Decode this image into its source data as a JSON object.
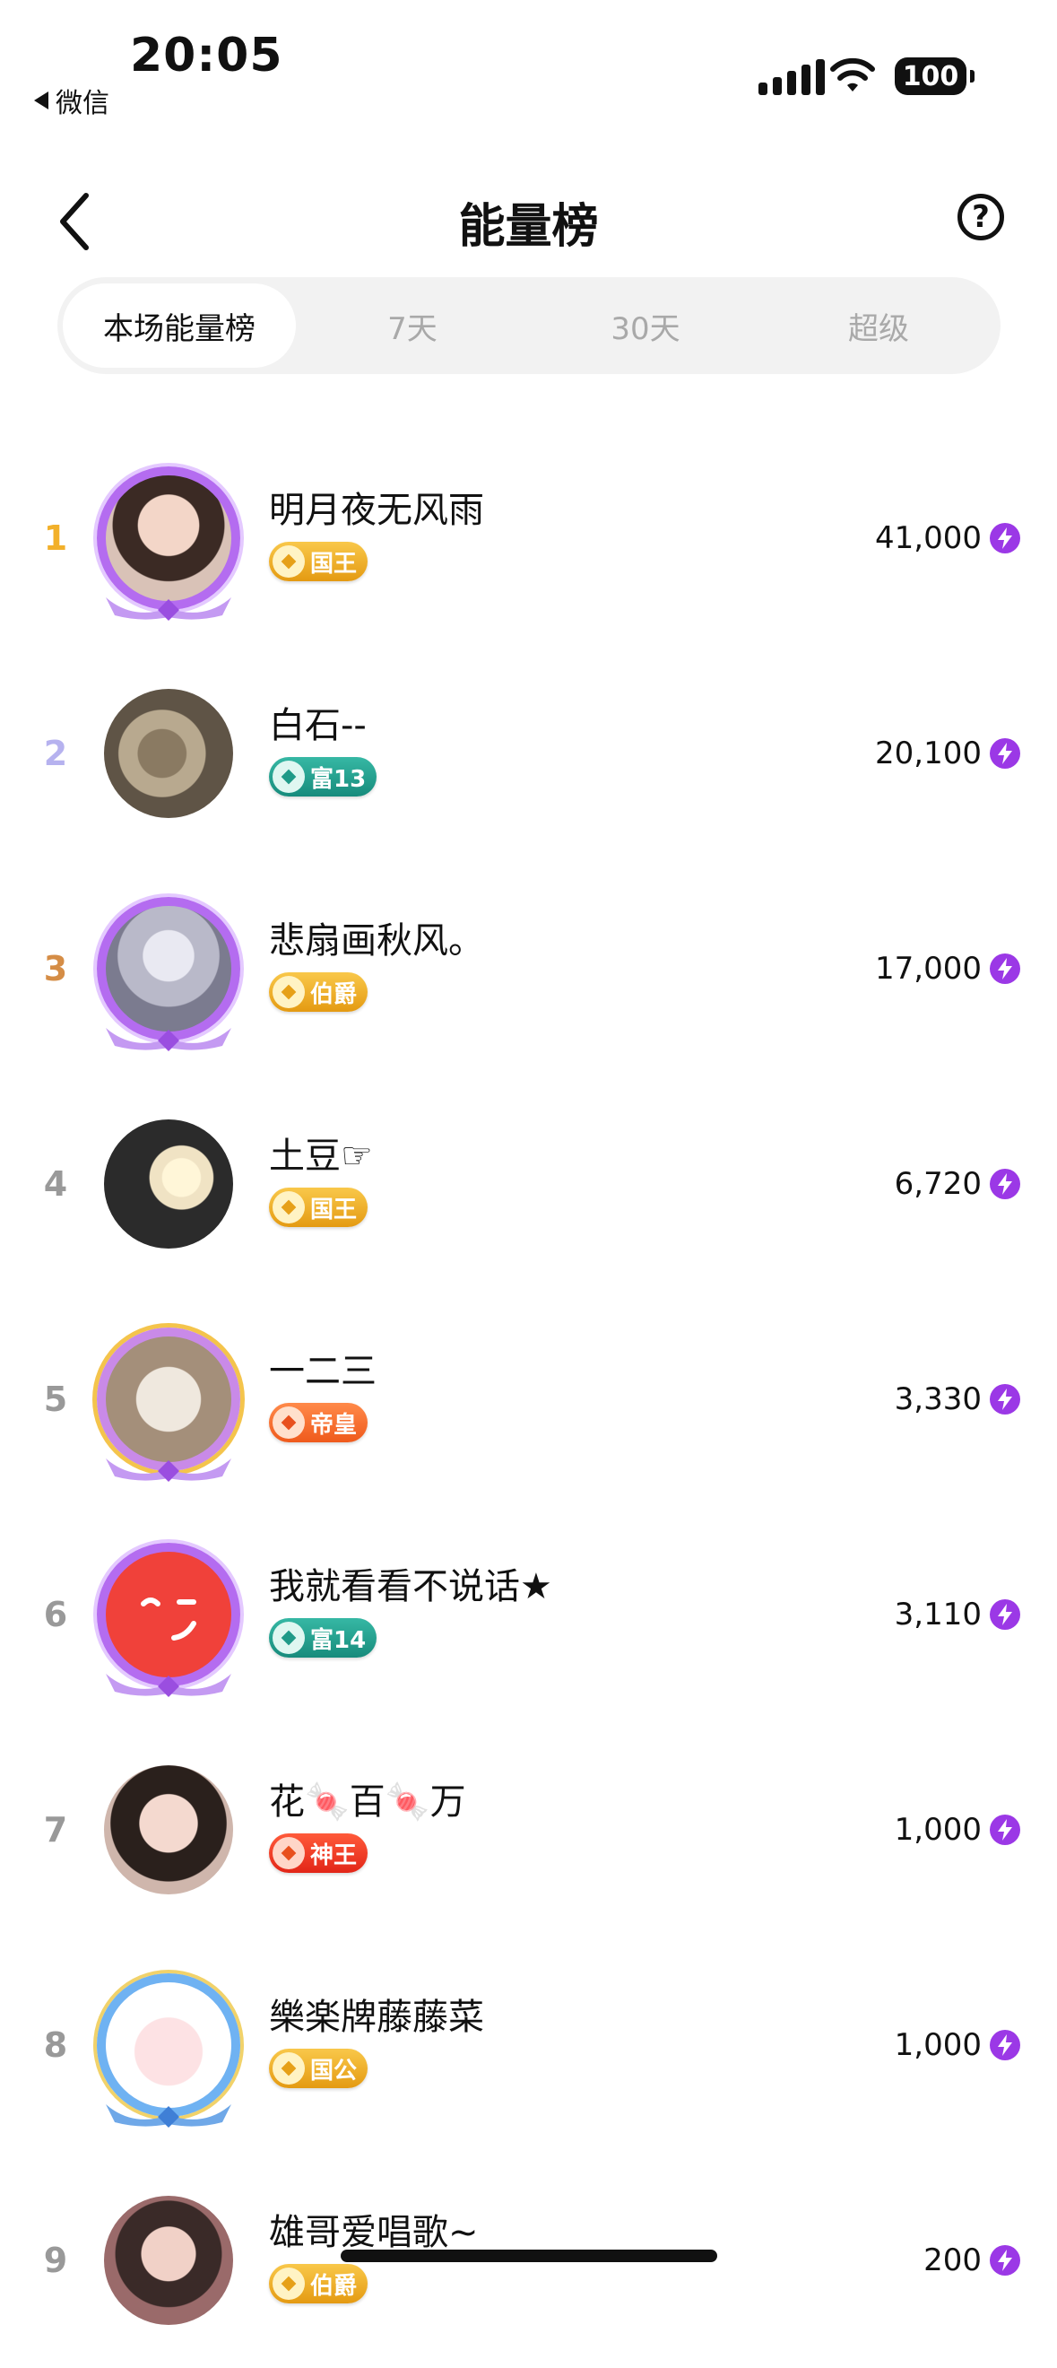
{
  "status_bar": {
    "time": "20:05",
    "back_app": "微信",
    "battery": "100"
  },
  "header": {
    "title": "能量榜",
    "help": "?"
  },
  "tabs": [
    {
      "label": "本场能量榜",
      "active": true
    },
    {
      "label": "7天",
      "active": false
    },
    {
      "label": "30天",
      "active": false
    },
    {
      "label": "超级",
      "active": false
    }
  ],
  "colors": {
    "rank1": "#f2b02a",
    "rank2": "#b6b2ef",
    "rank3": "#d58d46",
    "rank_default": "#999999",
    "bolt": "#9b38e6"
  },
  "entries": [
    {
      "rank": "1",
      "name": "明月夜无风雨",
      "badge": "国王",
      "badge_style": "gold",
      "score": "41,000",
      "frame": "purple",
      "avatar_icon": "girl-avatar"
    },
    {
      "rank": "2",
      "name": "白石--",
      "badge": "富13",
      "badge_style": "teal",
      "score": "20,100",
      "frame": "none",
      "avatar_icon": "animals-avatar"
    },
    {
      "rank": "3",
      "name": "悲扇画秋风。",
      "badge": "伯爵",
      "badge_style": "gold",
      "score": "17,000",
      "frame": "purple",
      "avatar_icon": "warrior-avatar"
    },
    {
      "rank": "4",
      "name": "土豆☞",
      "badge": "国王",
      "badge_style": "gold",
      "score": "6,720",
      "frame": "none",
      "avatar_icon": "climbers-avatar"
    },
    {
      "rank": "5",
      "name": "一二三",
      "badge": "帝皇",
      "badge_style": "orange",
      "score": "3,330",
      "frame": "gold",
      "avatar_icon": "puppies-avatar"
    },
    {
      "rank": "6",
      "name": "我就看看不说话★",
      "badge": "富14",
      "badge_style": "teal",
      "score": "3,110",
      "frame": "purple",
      "avatar_icon": "red-face-avatar"
    },
    {
      "rank": "7",
      "name": "花🍬百🍬万",
      "badge": "神王",
      "badge_style": "red",
      "score": "1,000",
      "frame": "none",
      "avatar_icon": "woman-avatar"
    },
    {
      "rank": "8",
      "name": "樂楽牌藤藤菜",
      "badge": "国公",
      "badge_style": "gold",
      "score": "1,000",
      "frame": "blue",
      "avatar_icon": "pig-avatar"
    },
    {
      "rank": "9",
      "name": "雄哥爱唱歌~",
      "badge": "伯爵",
      "badge_style": "gold",
      "score": "200",
      "frame": "none",
      "avatar_icon": "singer-avatar"
    }
  ]
}
